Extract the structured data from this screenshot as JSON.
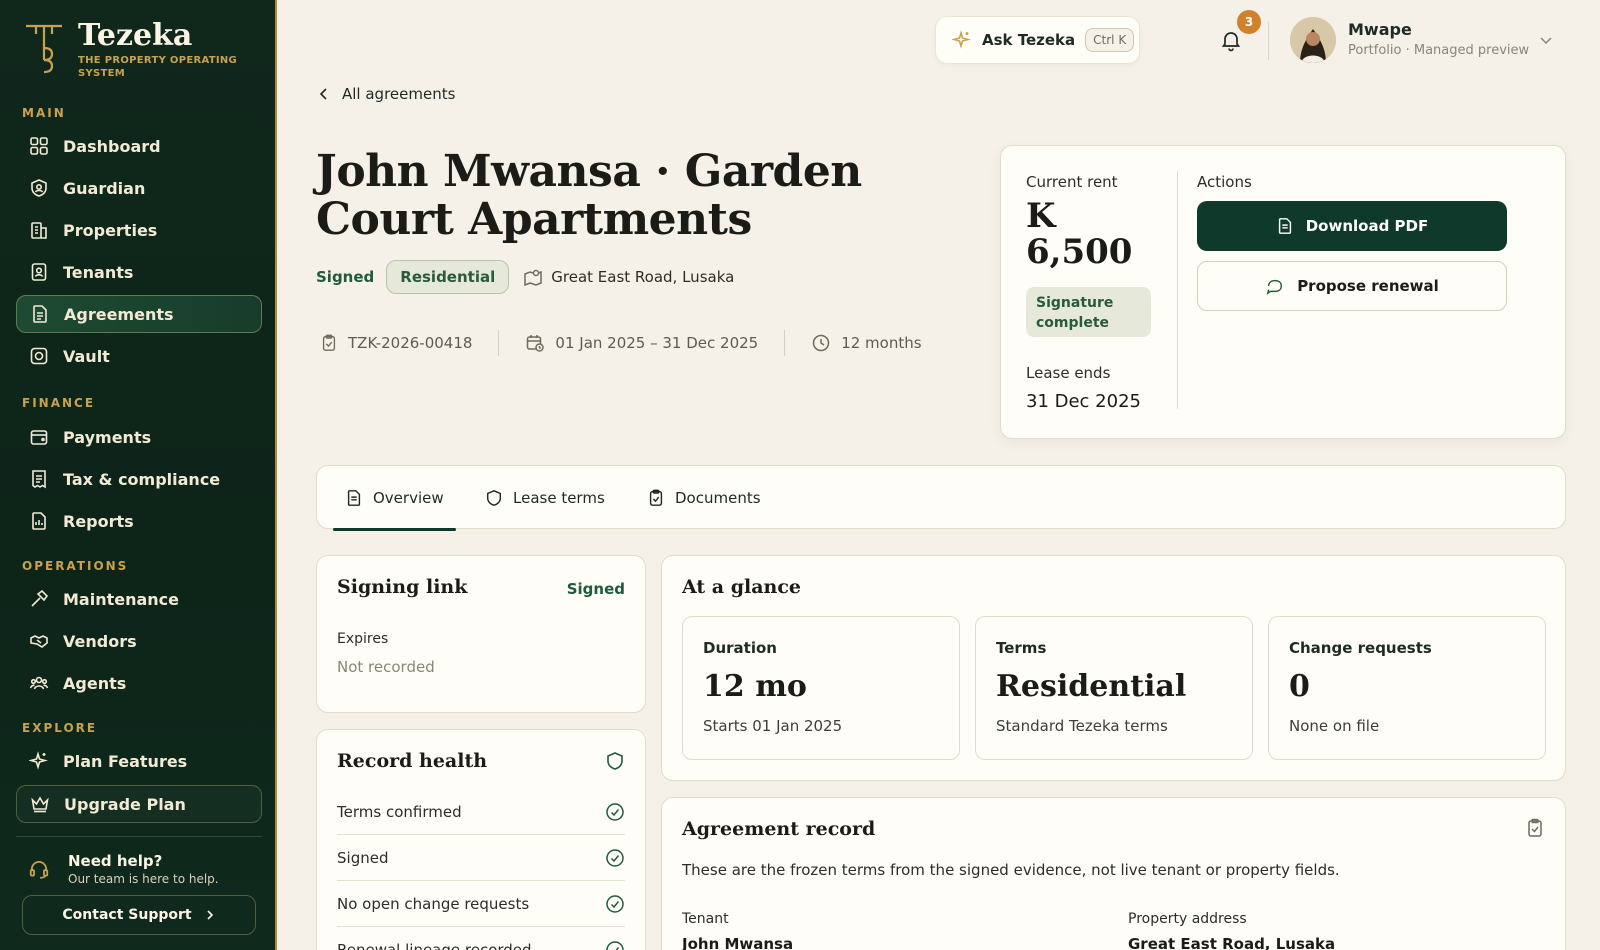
{
  "brand": {
    "name": "Tezeka",
    "tagline": "THE PROPERTY OPERATING SYSTEM"
  },
  "nav": {
    "main_label": "MAIN",
    "main": [
      {
        "label": "Dashboard",
        "icon": "grid-icon"
      },
      {
        "label": "Guardian",
        "icon": "shield-user-icon"
      },
      {
        "label": "Properties",
        "icon": "building-icon"
      },
      {
        "label": "Tenants",
        "icon": "id-card-icon"
      },
      {
        "label": "Agreements",
        "icon": "document-icon",
        "active": true
      },
      {
        "label": "Vault",
        "icon": "vault-icon"
      }
    ],
    "finance_label": "FINANCE",
    "finance": [
      {
        "label": "Payments",
        "icon": "wallet-icon"
      },
      {
        "label": "Tax & compliance",
        "icon": "receipt-icon"
      },
      {
        "label": "Reports",
        "icon": "report-icon"
      }
    ],
    "operations_label": "OPERATIONS",
    "operations": [
      {
        "label": "Maintenance",
        "icon": "hammer-icon"
      },
      {
        "label": "Vendors",
        "icon": "handshake-icon"
      },
      {
        "label": "Agents",
        "icon": "users-icon"
      }
    ],
    "explore_label": "EXPLORE",
    "explore": [
      {
        "label": "Plan Features",
        "icon": "sparkle-icon"
      },
      {
        "label": "Upgrade Plan",
        "icon": "crown-icon"
      }
    ]
  },
  "help": {
    "title": "Need help?",
    "subtitle": "Our team is here to help.",
    "contact": "Contact Support"
  },
  "topbar": {
    "ask_label": "Ask Tezeka",
    "ask_shortcut": "Ctrl K",
    "notifications": "3",
    "user_name": "Mwape",
    "user_sub": "Portfolio · Managed preview"
  },
  "header": {
    "back_label": "All agreements",
    "title": "John Mwansa · Garden Court Apartments",
    "status": "Signed",
    "type": "Residential",
    "location": "Great East Road, Lusaka",
    "ref": "TZK-2026-00418",
    "period": "01 Jan 2025 – 31 Dec 2025",
    "duration": "12 months"
  },
  "rent_card": {
    "current_rent_label": "Current rent",
    "current_rent": "K 6,500",
    "signature_status": "Signature complete",
    "lease_ends_label": "Lease ends",
    "lease_ends": "31 Dec 2025",
    "actions_label": "Actions",
    "download_label": "Download PDF",
    "renewal_label": "Propose renewal"
  },
  "tabs": [
    {
      "label": "Overview",
      "active": true
    },
    {
      "label": "Lease terms"
    },
    {
      "label": "Documents"
    }
  ],
  "signing": {
    "title": "Signing link",
    "status": "Signed",
    "expires_label": "Expires",
    "expires_value": "Not recorded"
  },
  "glance": {
    "title": "At a glance",
    "items": [
      {
        "label": "Duration",
        "value": "12 mo",
        "sub": "Starts 01 Jan 2025"
      },
      {
        "label": "Terms",
        "value": "Residential",
        "sub": "Standard Tezeka terms"
      },
      {
        "label": "Change requests",
        "value": "0",
        "sub": "None on file"
      }
    ]
  },
  "health": {
    "title": "Record health",
    "items": [
      "Terms confirmed",
      "Signed",
      "No open change requests",
      "Renewal lineage recorded"
    ]
  },
  "record": {
    "title": "Agreement record",
    "description": "These are the frozen terms from the signed evidence, not live tenant or property fields.",
    "tenant_label": "Tenant",
    "tenant_value": "John Mwansa",
    "address_label": "Property address",
    "address_value": "Great East Road, Lusaka"
  }
}
